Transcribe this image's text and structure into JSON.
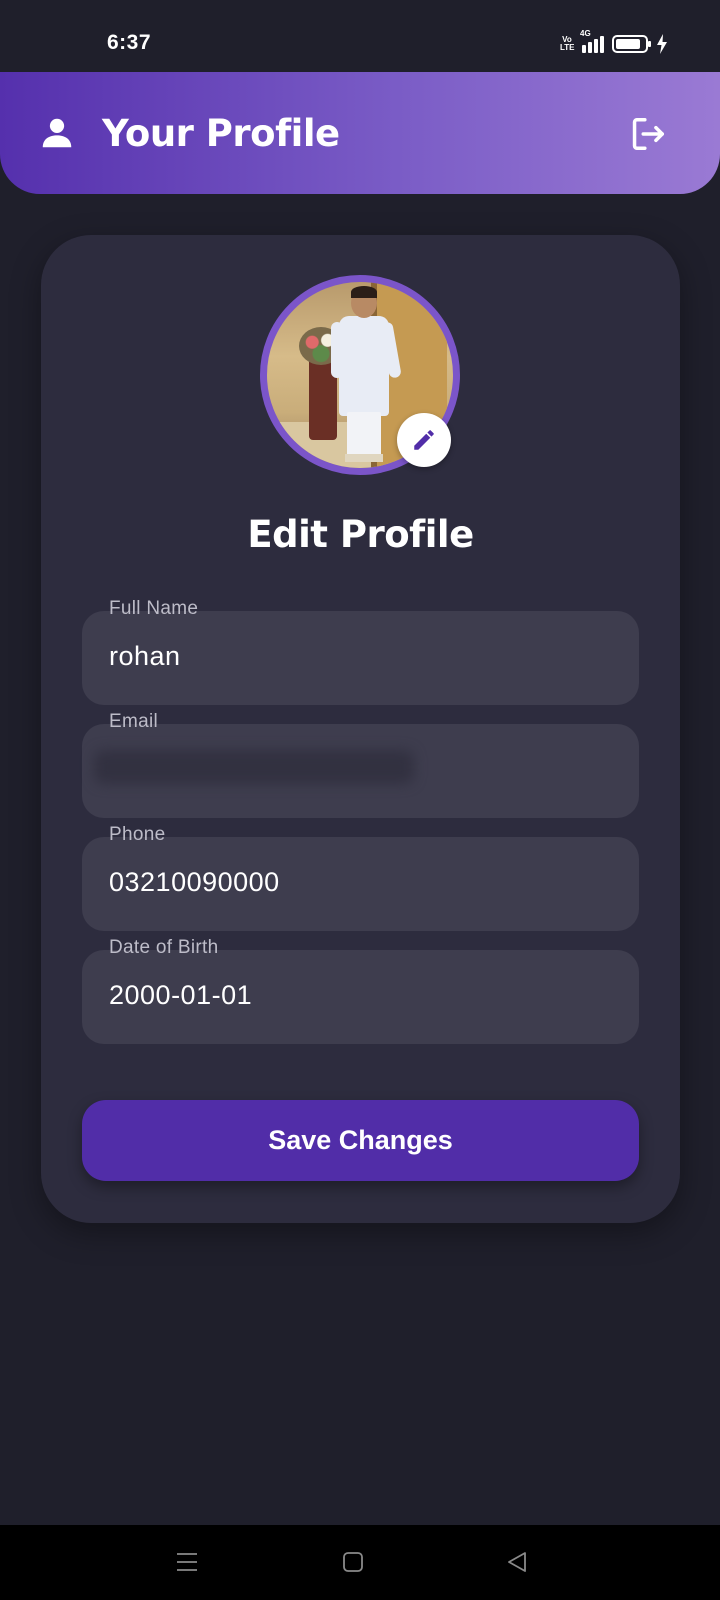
{
  "status_bar": {
    "time": "6:37",
    "volte_label": "Vo LTE",
    "network_label": "4G",
    "battery_level": 0.85
  },
  "header": {
    "title": "Your Profile",
    "icon": "person-icon",
    "action_icon": "logout-icon"
  },
  "profile": {
    "title": "Edit Profile",
    "edit_icon": "pencil-icon",
    "fields": [
      {
        "label": "Full Name",
        "value": "rohan"
      },
      {
        "label": "Email",
        "value": ""
      },
      {
        "label": "Phone",
        "value": "03210090000"
      },
      {
        "label": "Date of Birth",
        "value": "2000-01-01"
      }
    ],
    "save_label": "Save Changes"
  },
  "colors": {
    "background": "#1f1f2b",
    "card": "#2d2c3e",
    "field": "#3e3d4e",
    "accent": "#512da8",
    "header_gradient_start": "#5530ad",
    "header_gradient_end": "#9a7ad4"
  },
  "nav_bar": {
    "icons": [
      "menu-icon",
      "home-square-icon",
      "back-triangle-icon"
    ]
  }
}
